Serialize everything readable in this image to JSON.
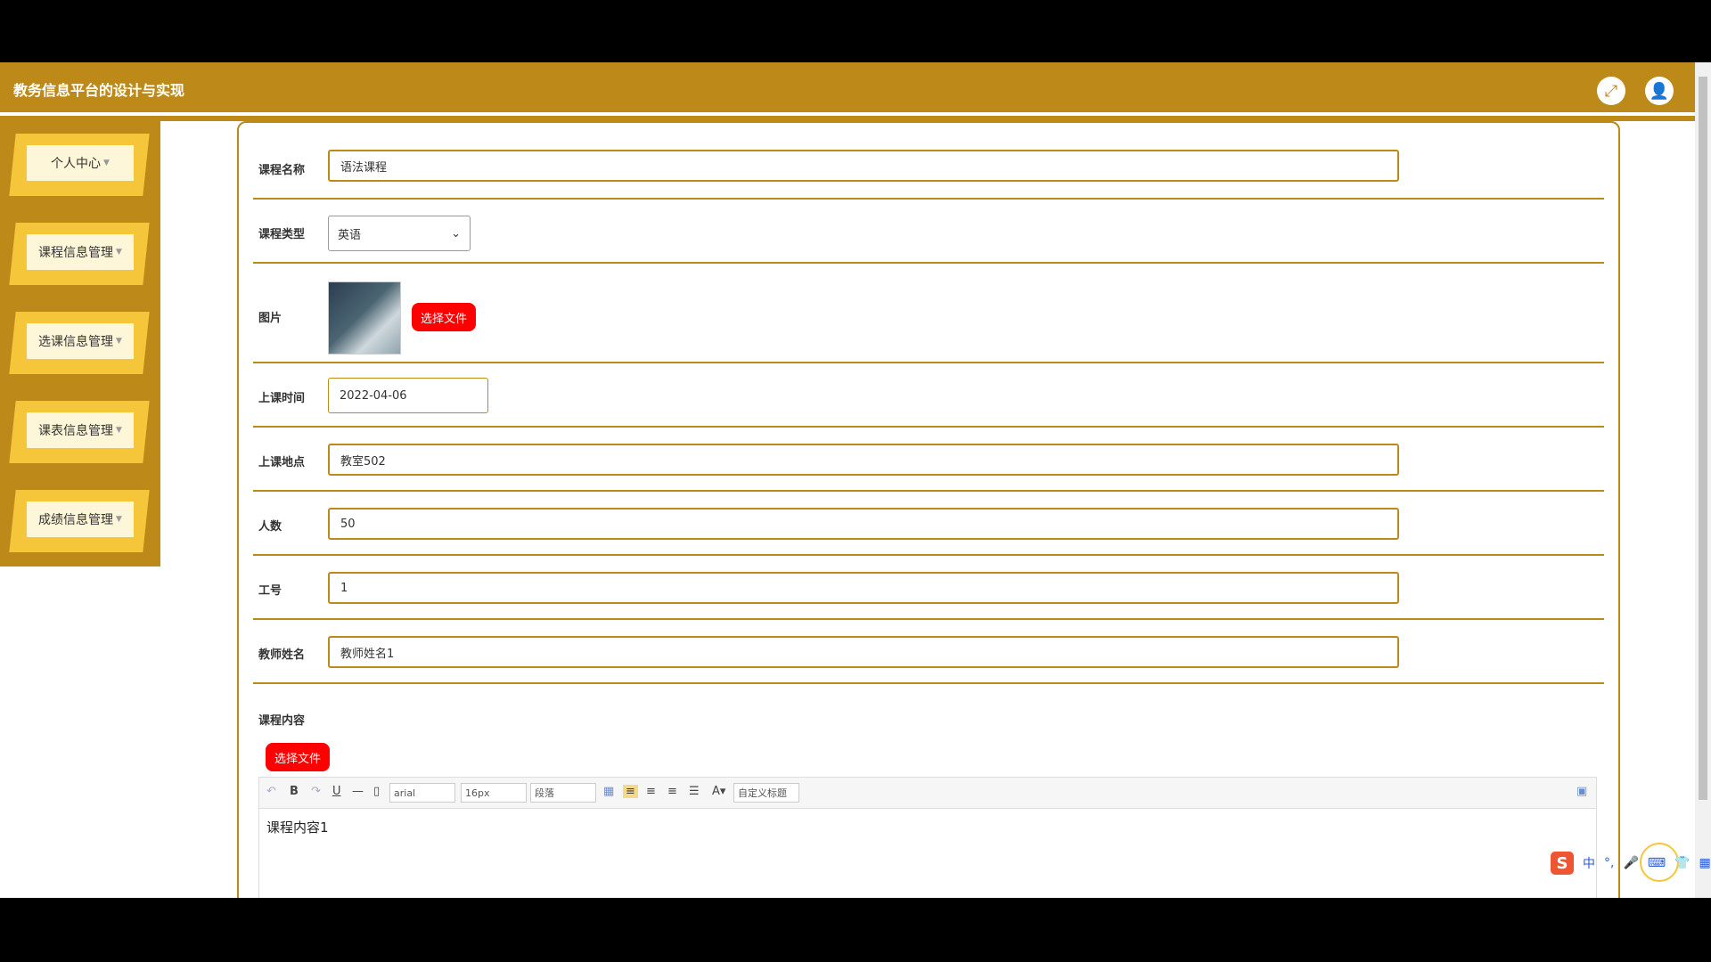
{
  "app": {
    "title": "教务信息平台的设计与实现"
  },
  "header_icons": {
    "fullscreen": "fullscreen-icon",
    "user": "user-icon"
  },
  "sidebar": {
    "items": [
      {
        "label": "个人中心"
      },
      {
        "label": "课程信息管理"
      },
      {
        "label": "选课信息管理"
      },
      {
        "label": "课表信息管理"
      },
      {
        "label": "成绩信息管理"
      }
    ]
  },
  "form": {
    "course_name": {
      "label": "课程名称",
      "value": "语法课程"
    },
    "course_type": {
      "label": "课程类型",
      "value": "英语"
    },
    "image": {
      "label": "图片",
      "button": "选择文件"
    },
    "class_time": {
      "label": "上课时间",
      "value": "2022-04-06"
    },
    "location": {
      "label": "上课地点",
      "value": "教室502"
    },
    "capacity": {
      "label": "人数",
      "value": "50"
    },
    "staff_id": {
      "label": "工号",
      "value": "1"
    },
    "teacher_name": {
      "label": "教师姓名",
      "value": "教师姓名1"
    },
    "content": {
      "label": "课程内容",
      "button": "选择文件"
    }
  },
  "editor": {
    "font": "arial",
    "size": "16px",
    "paragraph": "段落",
    "custom_title": "自定义标题",
    "content": "课程内容1"
  },
  "ime": {
    "lang": "中",
    "punct": "°,",
    "logo": "S"
  },
  "colors": {
    "accent": "#bd8a1a",
    "menu_bevel": "#f5c63a",
    "danger": "#ff0000"
  }
}
